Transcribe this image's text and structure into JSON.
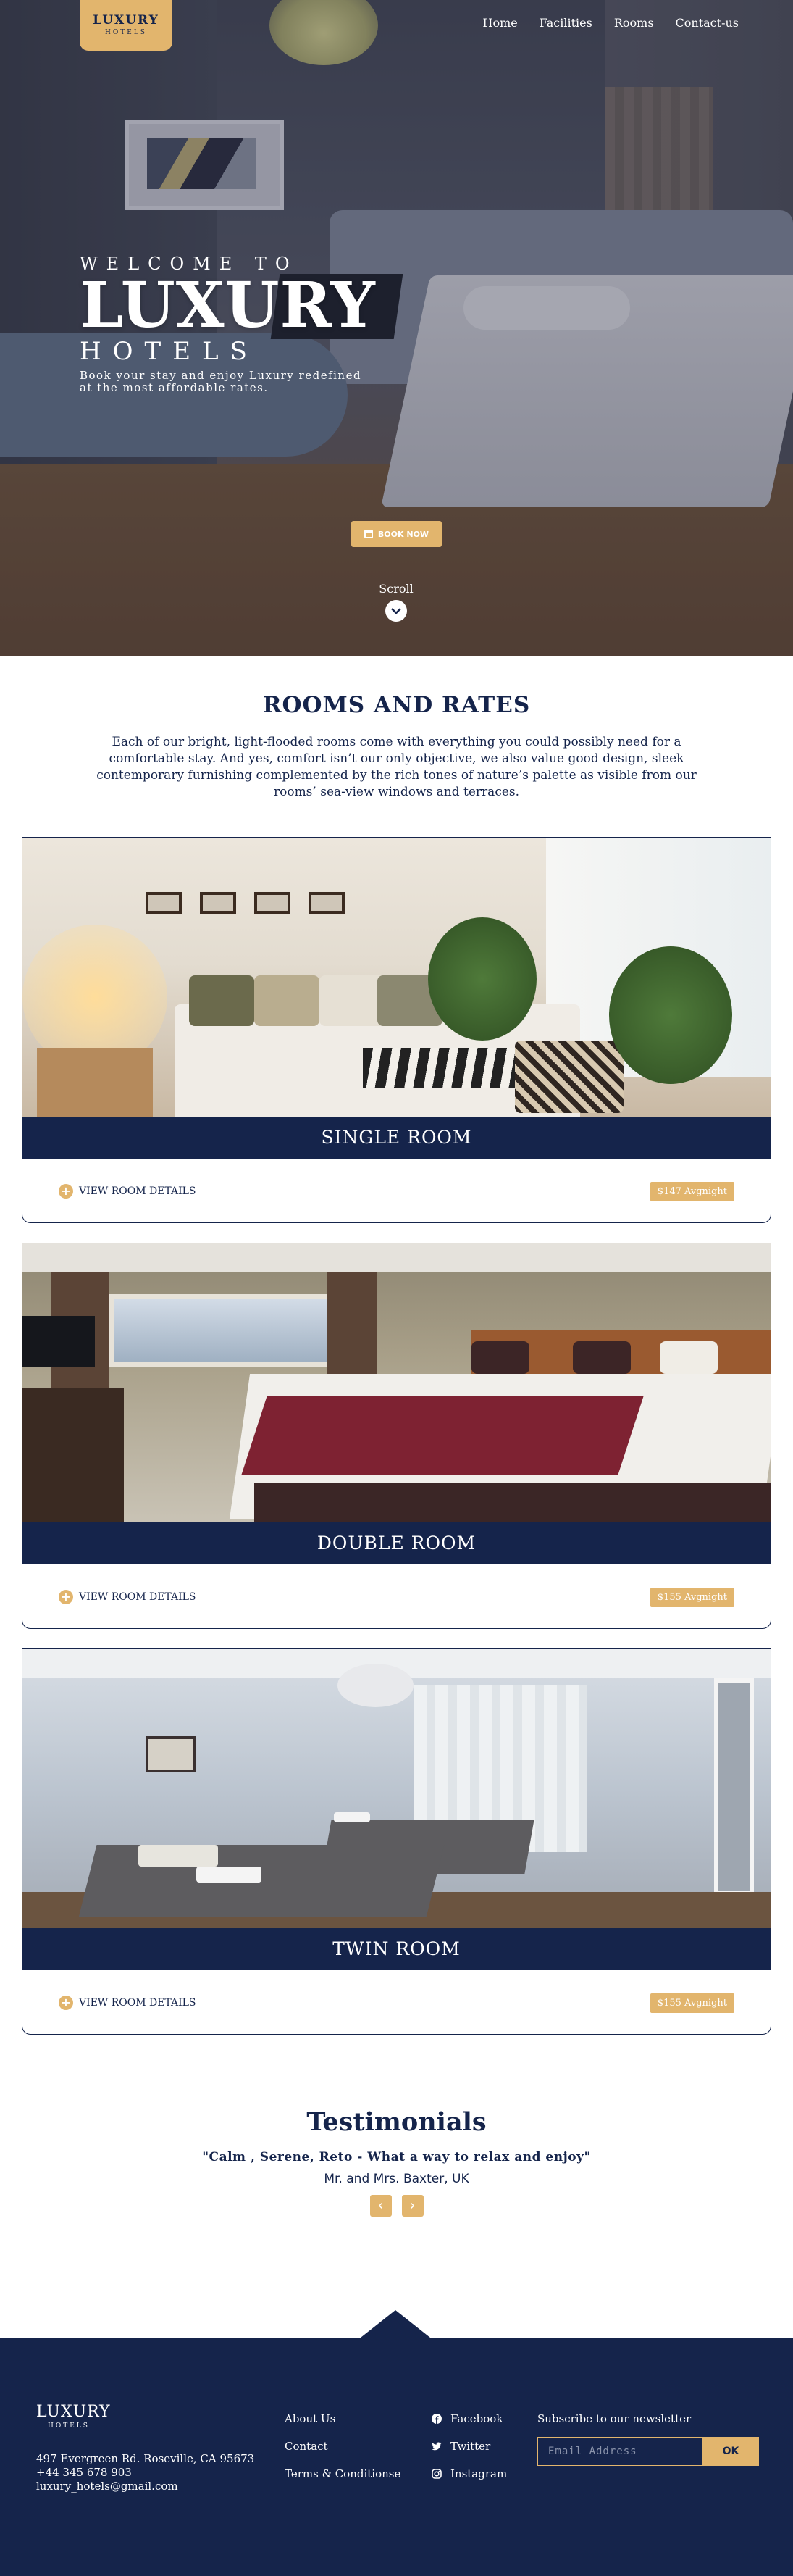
{
  "nav": {
    "logo_line1": "LUXURY",
    "logo_line2": "HOTELS",
    "items": [
      {
        "label": "Home",
        "active": false
      },
      {
        "label": "Facilities",
        "active": false
      },
      {
        "label": "Rooms",
        "active": true
      },
      {
        "label": "Contact-us",
        "active": false
      }
    ]
  },
  "hero": {
    "welcome": "WELCOME TO",
    "title": "LUXURY",
    "subtitle": "HOTELS",
    "tagline": "Book your stay and enjoy Luxury redefined at the most affordable rates.",
    "book_button": "BOOK NOW",
    "book_icon": "calendar-icon",
    "scroll_label": "Scroll",
    "scroll_icon": "chevron-down-icon"
  },
  "rooms": {
    "heading": "ROOMS AND RATES",
    "intro": "Each of our bright, light-flooded rooms come with everything you could possibly need for a comfortable stay. And yes, comfort isn’t our only objective, we also value good design, sleek contemporary furnishing complemented by the rich tones of nature’s palette as visible from our rooms’ sea-view windows and terraces.",
    "details_label": "VIEW ROOM DETAILS",
    "list": [
      {
        "name": "SINGLE ROOM",
        "price": "$147 Avgnight"
      },
      {
        "name": "DOUBLE ROOM",
        "price": "$155 Avgnight"
      },
      {
        "name": "TWIN ROOM",
        "price": "$155 Avgnight"
      }
    ]
  },
  "testimonials": {
    "heading": "Testimonials",
    "quote": "\"Calm , Serene, Reto - What a way to relax and enjoy\"",
    "author": "Mr. and Mrs. Baxter, UK",
    "prev": "‹",
    "next": "›"
  },
  "footer": {
    "logo_line1": "LUXURY",
    "logo_line2": "HOTELS",
    "address": "497 Evergreen Rd. Roseville, CA 95673",
    "phone": "+44 345 678 903",
    "email": "luxury_hotels@gmail.com",
    "links": [
      "About Us",
      "Contact",
      "Terms & Conditionse"
    ],
    "social": [
      {
        "label": "Facebook",
        "icon": "facebook-icon"
      },
      {
        "label": "Twitter",
        "icon": "twitter-icon"
      },
      {
        "label": "Instagram",
        "icon": "instagram-icon"
      }
    ],
    "newsletter_label": "Subscribe to our newsletter",
    "email_placeholder": "Email Address",
    "ok_label": "OK"
  },
  "colors": {
    "navy": "#15244b",
    "gold": "#e2b56d"
  }
}
